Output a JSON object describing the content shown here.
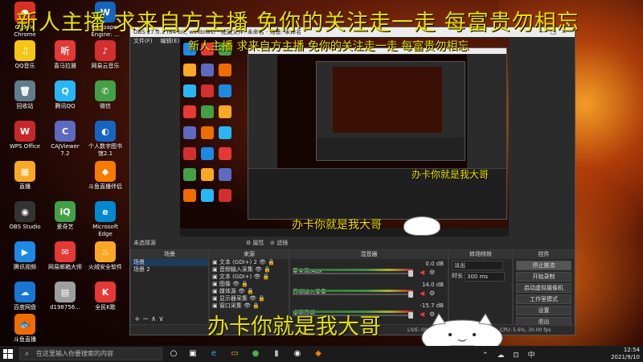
{
  "banner": "新人主播 求来自方主播 免你的关注走一走 每富贵勿相忘",
  "caption": "办卡你就是我大哥",
  "desktop_icons": [
    {
      "label": "Google Chrome",
      "color": "#d93025",
      "glyph": "●"
    },
    {
      "label": "QQ音乐",
      "color": "#f5c518",
      "glyph": "♫"
    },
    {
      "label": "回收站",
      "color": "#607d8b",
      "glyph": "🗑"
    },
    {
      "label": "WPS Office",
      "color": "#c62828",
      "glyph": "W"
    },
    {
      "label": "直播",
      "color": "#f9a825",
      "glyph": "▦"
    },
    {
      "label": "OBS Studio",
      "color": "#333333",
      "glyph": "◉"
    },
    {
      "label": "腾讯视频",
      "color": "#1e88e5",
      "glyph": "▶"
    },
    {
      "label": "百度网盘",
      "color": "#1976d2",
      "glyph": "☁"
    },
    {
      "label": "斗鱼直播",
      "color": "#ef6c00",
      "glyph": "🐟"
    },
    {
      "label": "喜马拉雅",
      "color": "#e53935",
      "glyph": "听"
    },
    {
      "label": "腾讯QQ",
      "color": "#29b6f6",
      "glyph": "Q"
    },
    {
      "label": "CAJViewer 7.2",
      "color": "#5c6bc0",
      "glyph": "C"
    },
    {
      "label": "爱奇艺",
      "color": "#43a047",
      "glyph": "iQ"
    },
    {
      "label": "网易邮箱大师",
      "color": "#e53935",
      "glyph": "✉"
    },
    {
      "label": "d198756...",
      "color": "#9e9e9e",
      "glyph": "▤"
    },
    {
      "label": "Wallpaper Engine: ...",
      "color": "#1565c0",
      "glyph": "W"
    },
    {
      "label": "网易云音乐",
      "color": "#d32f2f",
      "glyph": "♪"
    },
    {
      "label": "微信",
      "color": "#43a047",
      "glyph": "✆"
    },
    {
      "label": "个人数字图书馆2.1",
      "color": "#1565c0",
      "glyph": "◐"
    },
    {
      "label": "斗鱼直播伴侣",
      "color": "#f57c00",
      "glyph": "◆"
    },
    {
      "label": "Microsoft Edge",
      "color": "#0288d1",
      "glyph": "e"
    },
    {
      "label": "火绒安全软件",
      "color": "#f9a825",
      "glyph": "♨"
    },
    {
      "label": "全民K歌",
      "color": "#e53935",
      "glyph": "K"
    }
  ],
  "obs": {
    "title": "OBS 27.0.1 (64-bit, windows) - 配置文件: 未命名 - 场景: 未命名",
    "menu": [
      "文件(F)",
      "编辑(E)",
      "视图(V)",
      "停靠部件(D)",
      "配置文件(P)",
      "场景集合(S)",
      "工具(T)",
      "帮助(H)"
    ],
    "no_source": "未选择源",
    "properties_label": "⚙ 属性",
    "filters_label": "⊘ 滤镜",
    "docks": {
      "scenes_title": "场景",
      "scenes": [
        "场景",
        "场景 2"
      ],
      "sources_title": "来源",
      "sources": [
        "文本 (GDI+) 2",
        "音频输入采集",
        "文本 (GDI+)",
        "图像",
        "媒体源",
        "显示器采集",
        "窗口采集"
      ],
      "mixer_title": "混音器",
      "mixer": [
        {
          "name": "麦克风/Aux",
          "db": "0.0 dB"
        },
        {
          "name": "音频输入采集",
          "db": "14.0 dB"
        },
        {
          "name": "桌面音频",
          "db": "-15.7 dB"
        }
      ],
      "transitions_title": "转场特效",
      "transition_value": "淡出",
      "duration_label": "时长",
      "duration_value": "300 ms",
      "controls_title": "控件",
      "controls": [
        "停止推流",
        "开始录制",
        "启动虚拟摄像机",
        "工作室模式",
        "设置",
        "退出"
      ]
    },
    "status": {
      "live": "LIVE: 00:00:00",
      "cpu": "CPU: 5.6%, 30.00 fps"
    }
  },
  "taskbar": {
    "search_placeholder": "在这里输入你要搜索的内容",
    "time": "12:54",
    "date": "2021/9/10",
    "ime": "中"
  }
}
